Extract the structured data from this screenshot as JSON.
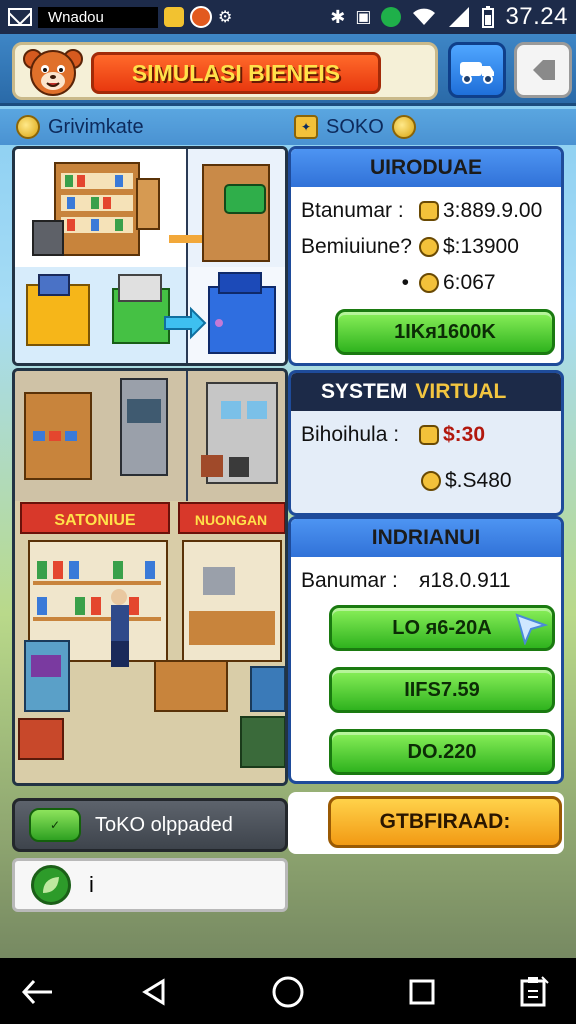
{
  "status_bar": {
    "app_name": "Wnadou",
    "time": "37.24"
  },
  "header": {
    "title": "SIMULASI BIENEIS"
  },
  "subheader": {
    "left_label": "Grivimkate",
    "right_label": "SOKO"
  },
  "overview_card": {
    "title": "UIRODUAE",
    "rows": [
      {
        "label": "Btanumar :",
        "value": "3:889.9.00"
      },
      {
        "label": "Bemiuiune?",
        "value": "$:13900"
      },
      {
        "label": "•",
        "value": "6:067"
      }
    ],
    "button": "1IKᴙ1600K"
  },
  "system_card": {
    "title_a": "SYSTEM",
    "title_b": "VIRTUAL",
    "row_label": "Bihoihula :",
    "row_value": "$:30",
    "value2": "$.S480"
  },
  "market_card": {
    "title": "INDRIANUI",
    "row_label": "Banumar :",
    "row_value": "ᴙ18.0.911",
    "buttons": [
      "LO ᴙ6-20A",
      "IIFS7.59",
      "DO.220"
    ]
  },
  "shop": {
    "sign_left": "SATONIUE",
    "sign_right": "NUONGAN"
  },
  "bottom": {
    "chip_label": "ToKO olppaded",
    "input_text": "i",
    "action_button": "GTBFIRAAD:"
  },
  "colors": {
    "accent_green": "#2fb31e",
    "accent_orange": "#f29a14",
    "accent_blue": "#3172d8",
    "title_red": "#e8380f"
  }
}
